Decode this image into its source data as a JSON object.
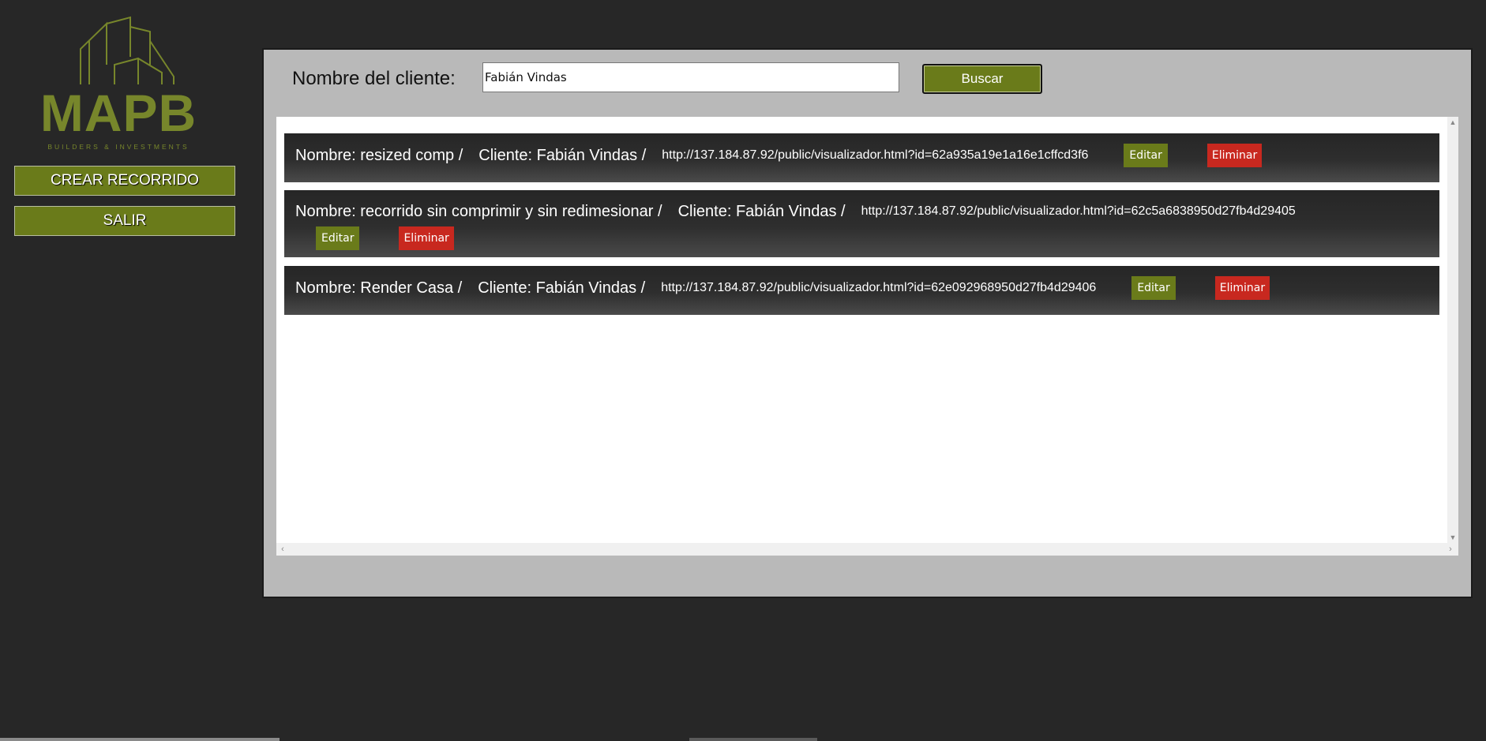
{
  "sidebar": {
    "logo": {
      "brand": "MAPB",
      "tagline": "BUILDERS & INVESTMENTS",
      "icon": "building-outline-logo"
    },
    "crear_label": "CREAR RECORRIDO",
    "salir_label": "SALIR"
  },
  "search": {
    "label": "Nombre del cliente:",
    "value": "Fabián Vindas",
    "button_label": "Buscar"
  },
  "results": [
    {
      "nombre": "Nombre: resized comp /",
      "cliente": "Cliente: Fabián Vindas /",
      "url": "http://137.184.87.92/public/visualizador.html?id=62a935a19e1a16e1cffcd3f6",
      "edit_label": "Editar",
      "delete_label": "Eliminar"
    },
    {
      "nombre": "Nombre: recorrido sin comprimir y sin redimesionar /",
      "cliente": "Cliente: Fabián Vindas /",
      "url": "http://137.184.87.92/public/visualizador.html?id=62c5a6838950d27fb4d29405",
      "edit_label": "Editar",
      "delete_label": "Eliminar"
    },
    {
      "nombre": "Nombre: Render Casa /",
      "cliente": "Cliente: Fabián Vindas /",
      "url": "http://137.184.87.92/public/visualizador.html?id=62e092968950d27fb4d29406",
      "edit_label": "Editar",
      "delete_label": "Eliminar"
    }
  ],
  "colors": {
    "background": "#272727",
    "accent_green": "#6a7b1a",
    "logo_olive": "#77862b",
    "danger_red": "#c8281f",
    "panel_gray": "#b9b9b9"
  }
}
